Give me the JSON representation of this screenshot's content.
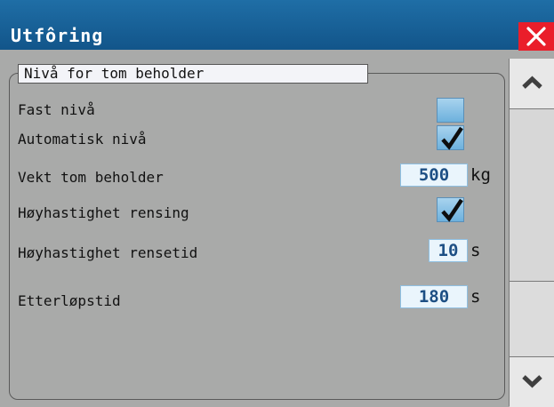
{
  "window": {
    "title": "Utfôring",
    "close_icon": "close-icon"
  },
  "group": {
    "label": "Nivå for tom beholder"
  },
  "rows": [
    {
      "label": "Fast nivå",
      "type": "checkbox",
      "checked": false
    },
    {
      "label": "Automatisk nivå",
      "type": "checkbox",
      "checked": true
    },
    {
      "label": "Vekt tom beholder",
      "type": "value",
      "value": "500",
      "unit": "kg"
    },
    {
      "label": "Høyhastighet rensing",
      "type": "checkbox",
      "checked": true
    },
    {
      "label": "Høyhastighet rensetid",
      "type": "value",
      "value": "10",
      "unit": "s"
    },
    {
      "label": "Etterløpstid",
      "type": "value",
      "value": "180",
      "unit": "s"
    }
  ],
  "scrollbar": {
    "up_icon": "chevron-up-icon",
    "down_icon": "chevron-down-icon"
  },
  "colors": {
    "titlebar": "#1a629b",
    "close": "#ea1e2a",
    "background": "#a9aaa9",
    "checkbox": "#8cc4e8",
    "value_text": "#1d4f84"
  }
}
